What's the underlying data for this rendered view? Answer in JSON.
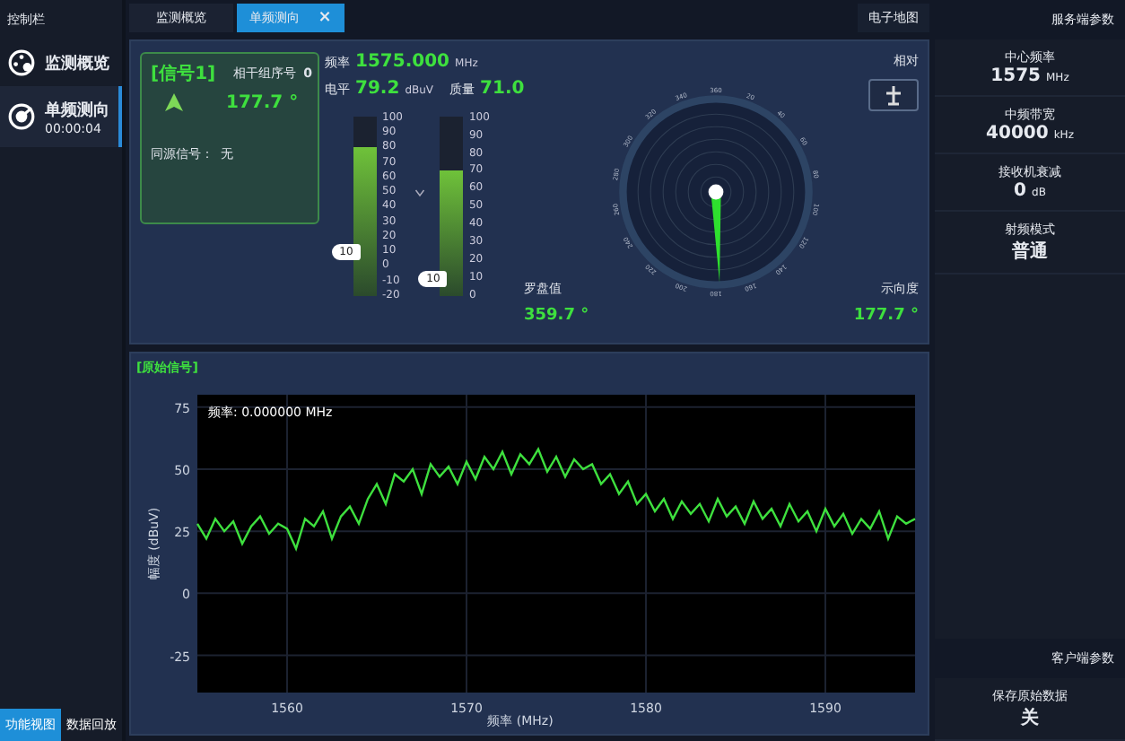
{
  "left_panel": {
    "title": "控制栏",
    "nav_items": [
      {
        "label": "监测概览",
        "selected": false,
        "kind": "overview"
      },
      {
        "label": "单频测向",
        "time": "00:00:04",
        "selected": true,
        "kind": "direction"
      }
    ],
    "bottom_tabs": [
      {
        "label": "功能视图",
        "selected": true
      },
      {
        "label": "数据回放",
        "selected": false
      }
    ]
  },
  "tabs": [
    {
      "label": "监测概览",
      "selected": false
    },
    {
      "label": "单频测向",
      "selected": true,
      "close": "×"
    }
  ],
  "map_tab": "电子地图",
  "signal_card": {
    "title": "[信号1]",
    "group_label": "相干组序号",
    "group_value": "0",
    "bearing": "177.7 °",
    "same_source_label": "同源信号：",
    "same_source_value": "无"
  },
  "metrics": {
    "frequency": {
      "label": "频率",
      "value": "1575.000",
      "unit": "MHz"
    },
    "level": {
      "label": "电平",
      "value": "79.2",
      "unit": "dBuV"
    },
    "quality": {
      "label": "质量",
      "value": "71.0"
    }
  },
  "gauges": [
    {
      "ticks": [
        "100",
        "90",
        "80",
        "70",
        "60",
        "50",
        "40",
        "30",
        "20",
        "10",
        "0",
        "-10",
        "-20"
      ],
      "level": 0.83,
      "thumb": "10"
    },
    {
      "ticks": [
        "100",
        "90",
        "80",
        "70",
        "60",
        "50",
        "40",
        "30",
        "20",
        "10",
        "0"
      ],
      "level": 0.7,
      "thumb": "10"
    }
  ],
  "compass": {
    "labels": [
      "360",
      "20",
      "40",
      "60",
      "80",
      "100",
      "120",
      "140",
      "160",
      "180",
      "200",
      "220",
      "240",
      "260",
      "280",
      "300",
      "320",
      "340"
    ],
    "compass_label": "罗盘值",
    "compass_value": "359.7 °",
    "bearing_label": "示向度",
    "bearing_value": "177.7 °",
    "relative_label": "相对"
  },
  "spectrum": {
    "title": "[原始信号]",
    "readout": "频率: 0.000000 MHz",
    "chart_data": {
      "type": "line",
      "xlabel": "频率 (MHz)",
      "ylabel": "幅度 (dBuV)",
      "xlim": [
        1555,
        1595
      ],
      "ylim": [
        -40,
        80
      ],
      "xticks": [
        1560,
        1570,
        1580,
        1590
      ],
      "yticks": [
        -25,
        0,
        25,
        50,
        75
      ],
      "grid": true,
      "x": [
        1555,
        1555.5,
        1556,
        1556.5,
        1557,
        1557.5,
        1558,
        1558.5,
        1559,
        1559.5,
        1560,
        1560.5,
        1561,
        1561.5,
        1562,
        1562.5,
        1563,
        1563.5,
        1564,
        1564.5,
        1565,
        1565.5,
        1566,
        1566.5,
        1567,
        1567.5,
        1568,
        1568.5,
        1569,
        1569.5,
        1570,
        1570.5,
        1571,
        1571.5,
        1572,
        1572.5,
        1573,
        1573.5,
        1574,
        1574.5,
        1575,
        1575.5,
        1576,
        1576.5,
        1577,
        1577.5,
        1578,
        1578.5,
        1579,
        1579.5,
        1580,
        1580.5,
        1581,
        1581.5,
        1582,
        1582.5,
        1583,
        1583.5,
        1584,
        1584.5,
        1585,
        1585.5,
        1586,
        1586.5,
        1587,
        1587.5,
        1588,
        1588.5,
        1589,
        1589.5,
        1590,
        1590.5,
        1591,
        1591.5,
        1592,
        1592.5,
        1593,
        1593.5,
        1594,
        1594.5,
        1595
      ],
      "series": [
        {
          "color": "#3ee03e",
          "values": [
            28,
            22,
            30,
            25,
            29,
            20,
            27,
            31,
            24,
            28,
            26,
            18,
            30,
            27,
            33,
            22,
            31,
            35,
            28,
            38,
            44,
            36,
            48,
            45,
            50,
            40,
            52,
            47,
            51,
            44,
            53,
            46,
            55,
            50,
            57,
            48,
            56,
            52,
            58,
            49,
            55,
            47,
            54,
            50,
            52,
            44,
            48,
            40,
            45,
            36,
            40,
            33,
            38,
            30,
            37,
            32,
            36,
            29,
            38,
            31,
            35,
            28,
            37,
            30,
            34,
            27,
            36,
            29,
            33,
            25,
            34,
            27,
            32,
            24,
            30,
            26,
            33,
            22,
            31,
            28,
            30
          ]
        }
      ]
    }
  },
  "server_params": {
    "title": "服务端参数",
    "items": [
      {
        "label": "中心频率",
        "value": "1575",
        "unit": "MHz"
      },
      {
        "label": "中频带宽",
        "value": "40000",
        "unit": "kHz"
      },
      {
        "label": "接收机衰减",
        "value": "0",
        "unit": "dB"
      },
      {
        "label": "射频模式",
        "value": "普通"
      }
    ]
  },
  "client_params": {
    "title": "客户端参数",
    "items": [
      {
        "label": "保存原始数据",
        "value": "关"
      }
    ]
  }
}
